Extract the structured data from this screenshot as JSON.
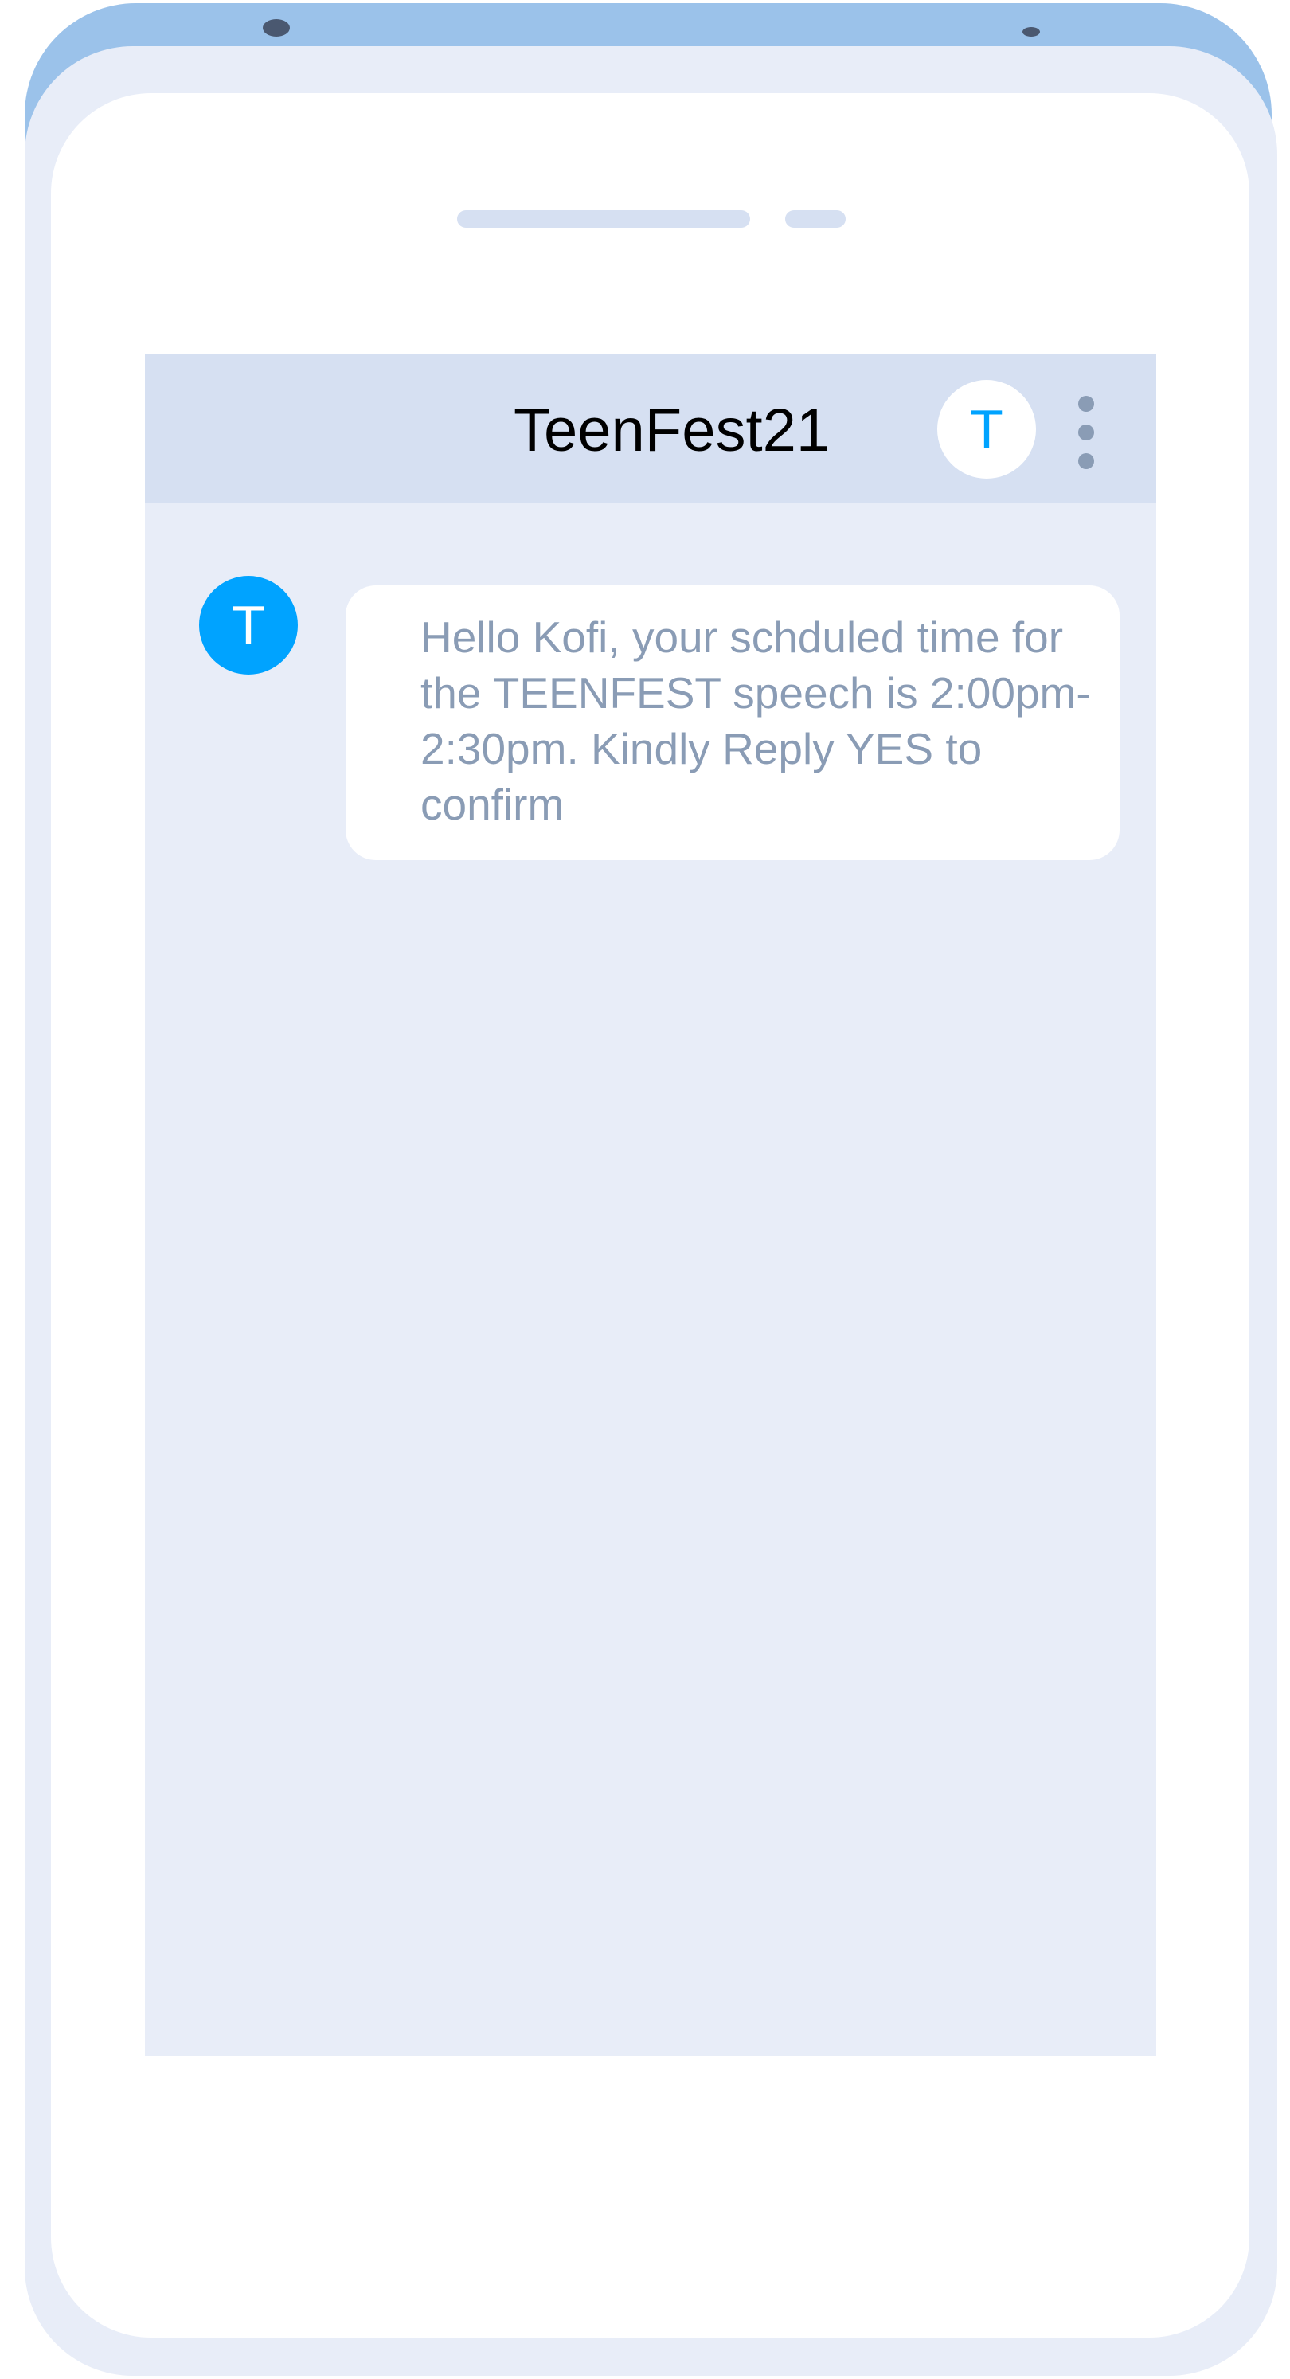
{
  "chat": {
    "title": "TeenFest21",
    "header_avatar_initial": "T",
    "more_icon": "vertical-ellipsis"
  },
  "message": {
    "sender_initial": "T",
    "text": "Hello Kofi, your schduled time for the TEENFEST speech is 2:00pm-2:30pm. Kindly Reply YES to confirm"
  },
  "colors": {
    "phone_back": "#9bc2ea",
    "bezel": "#e8edf8",
    "header_bg": "#d6e0f2",
    "avatar_accent": "#00a3ff",
    "message_text": "#8a9cb5"
  }
}
